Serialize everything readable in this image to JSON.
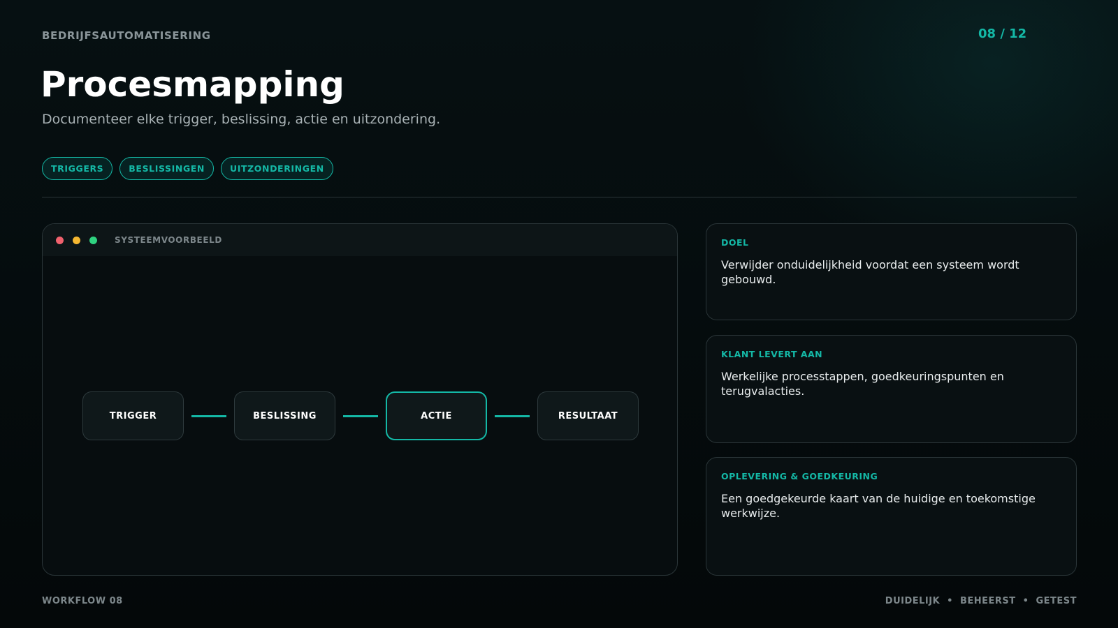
{
  "header": {
    "eyebrow": "BEDRIJFSAUTOMATISERING",
    "pager": "08 / 12",
    "title": "Procesmapping",
    "subtitle": "Documenteer elke trigger, beslissing, actie en uitzondering."
  },
  "chips": [
    "TRIGGERS",
    "BESLISSINGEN",
    "UITZONDERINGEN"
  ],
  "window": {
    "label": "SYSTEEMVOORBEELD",
    "flow": [
      "TRIGGER",
      "BESLISSING",
      "ACTIE",
      "RESULTAAT"
    ],
    "active_step": "ACTIE"
  },
  "cards": [
    {
      "label": "DOEL",
      "text": "Verwijder onduidelijkheid voordat een systeem wordt gebouwd."
    },
    {
      "label": "KLANT LEVERT AAN",
      "text": "Werkelijke processtappen, goedkeuringspunten en terugvalacties."
    },
    {
      "label": "OPLEVERING & GOEDKEURING",
      "text": "Een goedgekeurde kaart van de huidige en toekomstige werkwijze."
    }
  ],
  "footer": {
    "left": "WORKFLOW 08",
    "tags": [
      "DUIDELIJK",
      "BEHEERST",
      "GETEST"
    ],
    "separator": "•"
  },
  "colors": {
    "accent": "#14b8a6",
    "background": "#050a0c",
    "dot_red": "#f0616d",
    "dot_yellow": "#f5b731",
    "dot_green": "#2fd280"
  }
}
